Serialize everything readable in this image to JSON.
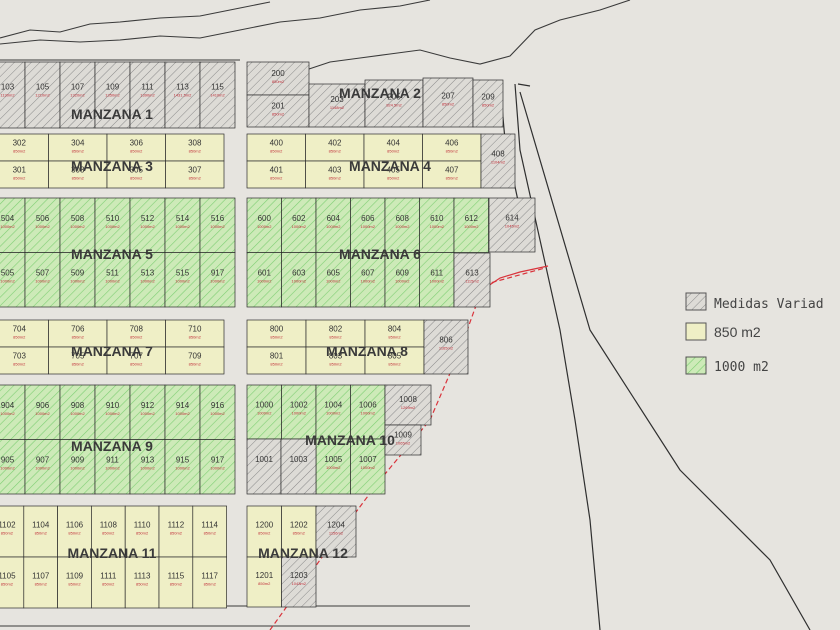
{
  "legend": {
    "items": [
      {
        "key": "varied",
        "label": "Medidas Variad",
        "mono": true
      },
      {
        "key": "850",
        "label": "850 m2",
        "mono": false
      },
      {
        "key": "1000",
        "label": "1000 m2",
        "mono": true
      }
    ]
  },
  "colors": {
    "background": "#e6e4df",
    "lot_850": "#efefc6",
    "lot_1000": "#cdeab8",
    "lot_1000_hatch": "#7fcf74",
    "lot_varied": "#dddbd6",
    "hatch_gray": "#8a8a8a",
    "outline": "#2b2b2b",
    "area_text": "#c0303a",
    "property_line": "#d9333b"
  },
  "manzanas": [
    {
      "id": "m1",
      "label": "MANZANA 1",
      "type": "varied",
      "rows": [
        [
          {
            "n": "103",
            "a": "1130m2"
          },
          {
            "n": "105",
            "a": "1210m2"
          },
          {
            "n": "107",
            "a": "1320m2"
          },
          {
            "n": "109",
            "a": "1350m2"
          },
          {
            "n": "111",
            "a": "1390m2"
          },
          {
            "n": "113",
            "a": "1431.5m2"
          },
          {
            "n": "115",
            "a": "1410m2"
          }
        ]
      ]
    },
    {
      "id": "m2",
      "label": "MANZANA 2",
      "type": "varied",
      "rows": [
        [
          {
            "n": "200",
            "a": "850m2"
          },
          {
            "n": "201",
            "a": "850m2"
          },
          {
            "n": "203",
            "a": "1148m2"
          },
          {
            "n": "205",
            "a": "924.5m2"
          },
          {
            "n": "207",
            "a": "850m2"
          },
          {
            "n": "209",
            "a": "850m2"
          }
        ]
      ]
    },
    {
      "id": "m3",
      "label": "MANZANA 3",
      "type": "850",
      "rows": [
        [
          {
            "n": "302",
            "a": "850m2"
          },
          {
            "n": "304",
            "a": "850m2"
          },
          {
            "n": "306",
            "a": "850m2"
          },
          {
            "n": "308",
            "a": "850m2"
          }
        ],
        [
          {
            "n": "301",
            "a": "850m2"
          },
          {
            "n": "303",
            "a": "850m2"
          },
          {
            "n": "305",
            "a": "850m2"
          },
          {
            "n": "307",
            "a": "850m2"
          }
        ]
      ]
    },
    {
      "id": "m4",
      "label": "MANZANA 4",
      "type": "850",
      "rows": [
        [
          {
            "n": "400",
            "a": "850m2"
          },
          {
            "n": "402",
            "a": "850m2"
          },
          {
            "n": "404",
            "a": "850m2"
          },
          {
            "n": "406",
            "a": "850m2"
          }
        ],
        [
          {
            "n": "401",
            "a": "850m2"
          },
          {
            "n": "403",
            "a": "850m2"
          },
          {
            "n": "405",
            "a": "850m2"
          },
          {
            "n": "407",
            "a": "850m2"
          }
        ],
        [
          {
            "n": "408",
            "a": "1104m2"
          }
        ]
      ]
    },
    {
      "id": "m5",
      "label": "MANZANA 5",
      "type": "1000",
      "rows": [
        [
          {
            "n": "504",
            "a": "1000m2"
          },
          {
            "n": "506",
            "a": "1000m2"
          },
          {
            "n": "508",
            "a": "1000m2"
          },
          {
            "n": "510",
            "a": "1000m2"
          },
          {
            "n": "512",
            "a": "1000m2"
          },
          {
            "n": "514",
            "a": "1000m2"
          },
          {
            "n": "516",
            "a": "1000m2"
          }
        ],
        [
          {
            "n": "505",
            "a": "1000m2"
          },
          {
            "n": "507",
            "a": "1000m2"
          },
          {
            "n": "509",
            "a": "1000m2"
          },
          {
            "n": "511",
            "a": "1000m2"
          },
          {
            "n": "513",
            "a": "1000m2"
          },
          {
            "n": "515",
            "a": "1000m2"
          },
          {
            "n": "917",
            "a": "1000m2"
          }
        ]
      ]
    },
    {
      "id": "m6",
      "label": "MANZANA 6",
      "type": "1000",
      "rows": [
        [
          {
            "n": "600",
            "a": "1000m2"
          },
          {
            "n": "602",
            "a": "1000m2"
          },
          {
            "n": "604",
            "a": "1000m2"
          },
          {
            "n": "606",
            "a": "1000m2"
          },
          {
            "n": "608",
            "a": "1000m2"
          },
          {
            "n": "610",
            "a": "1000m2"
          },
          {
            "n": "612",
            "a": "1000m2"
          }
        ],
        [
          {
            "n": "601",
            "a": "1000m2"
          },
          {
            "n": "603",
            "a": "1000m2"
          },
          {
            "n": "605",
            "a": "1000m2"
          },
          {
            "n": "607",
            "a": "1000m2"
          },
          {
            "n": "609",
            "a": "1000m2"
          },
          {
            "n": "611",
            "a": "1000m2"
          }
        ],
        [
          {
            "n": "614",
            "a": "1045m2"
          },
          {
            "n": "613",
            "a": "1115m2"
          }
        ]
      ]
    },
    {
      "id": "m7",
      "label": "MANZANA 7",
      "type": "850",
      "rows": [
        [
          {
            "n": "704",
            "a": "850m2"
          },
          {
            "n": "706",
            "a": "850m2"
          },
          {
            "n": "708",
            "a": "850m2"
          },
          {
            "n": "710",
            "a": "850m2"
          }
        ],
        [
          {
            "n": "703",
            "a": "850m2"
          },
          {
            "n": "705",
            "a": "850m2"
          },
          {
            "n": "707",
            "a": "850m2"
          },
          {
            "n": "709",
            "a": "850m2"
          }
        ]
      ]
    },
    {
      "id": "m8",
      "label": "MANZANA 8",
      "type": "850",
      "rows": [
        [
          {
            "n": "800",
            "a": "850m2"
          },
          {
            "n": "802",
            "a": "850m2"
          },
          {
            "n": "804",
            "a": "850m2"
          }
        ],
        [
          {
            "n": "801",
            "a": "850m2"
          },
          {
            "n": "803",
            "a": "850m2"
          },
          {
            "n": "805",
            "a": "850m2"
          }
        ],
        [
          {
            "n": "806",
            "a": "1165m2"
          }
        ]
      ]
    },
    {
      "id": "m9",
      "label": "MANZANA 9",
      "type": "1000",
      "rows": [
        [
          {
            "n": "904",
            "a": "1000m2"
          },
          {
            "n": "906",
            "a": "1000m2"
          },
          {
            "n": "908",
            "a": "1000m2"
          },
          {
            "n": "910",
            "a": "1000m2"
          },
          {
            "n": "912",
            "a": "1000m2"
          },
          {
            "n": "914",
            "a": "1000m2"
          },
          {
            "n": "916",
            "a": "1000m2"
          }
        ],
        [
          {
            "n": "905",
            "a": "1000m2"
          },
          {
            "n": "907",
            "a": "1000m2"
          },
          {
            "n": "909",
            "a": "1000m2"
          },
          {
            "n": "911",
            "a": "1000m2"
          },
          {
            "n": "913",
            "a": "1000m2"
          },
          {
            "n": "915",
            "a": "1000m2"
          },
          {
            "n": "917",
            "a": "1000m2"
          }
        ]
      ]
    },
    {
      "id": "m10",
      "label": "MANZANA 10",
      "type": "1000",
      "rows": [
        [
          {
            "n": "1000",
            "a": "1000m2"
          },
          {
            "n": "1002",
            "a": "1000m2"
          },
          {
            "n": "1004",
            "a": "1000m2"
          },
          {
            "n": "1006",
            "a": "1000m2"
          }
        ],
        [
          {
            "n": "1005",
            "a": "1000m2"
          },
          {
            "n": "1007",
            "a": "1000m2"
          }
        ],
        [
          {
            "n": "1008",
            "a": "1269m2"
          },
          {
            "n": "1009",
            "a": "1065m2"
          }
        ],
        [
          {
            "n": "1001",
            "a": ""
          },
          {
            "n": "1003",
            "a": ""
          }
        ]
      ]
    },
    {
      "id": "m11",
      "label": "MANZANA 11",
      "type": "850",
      "rows": [
        [
          {
            "n": "1102",
            "a": "850m2"
          },
          {
            "n": "1104",
            "a": "850m2"
          },
          {
            "n": "1106",
            "a": "850m2"
          },
          {
            "n": "1108",
            "a": "850m2"
          },
          {
            "n": "1110",
            "a": "850m2"
          },
          {
            "n": "1112",
            "a": "850m2"
          },
          {
            "n": "1114",
            "a": "850m2"
          }
        ],
        [
          {
            "n": "1105",
            "a": "850m2"
          },
          {
            "n": "1107",
            "a": "850m2"
          },
          {
            "n": "1109",
            "a": "850m2"
          },
          {
            "n": "1111",
            "a": "850m2"
          },
          {
            "n": "1113",
            "a": "850m2"
          },
          {
            "n": "1115",
            "a": "850m2"
          },
          {
            "n": "1117",
            "a": "850m2"
          }
        ]
      ]
    },
    {
      "id": "m12",
      "label": "MANZANA 12",
      "type": "850",
      "rows": [
        [
          {
            "n": "1200",
            "a": "850m2"
          },
          {
            "n": "1202",
            "a": "850m2"
          }
        ],
        [
          {
            "n": "1201",
            "a": "850m2"
          }
        ],
        [
          {
            "n": "1204",
            "a": "1156m2"
          },
          {
            "n": "1203",
            "a": "1043m2"
          }
        ]
      ]
    }
  ]
}
